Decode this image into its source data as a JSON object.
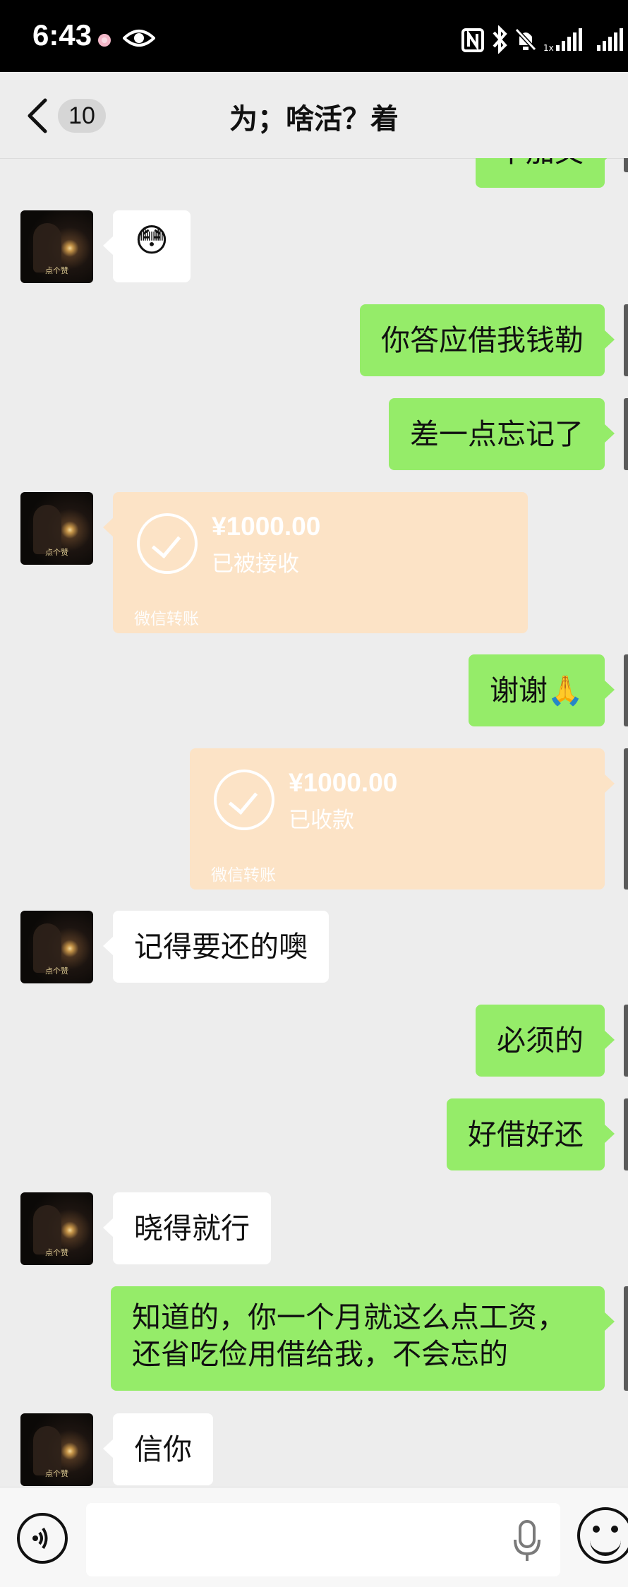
{
  "status_bar": {
    "time": "6:43",
    "icons": [
      "flower-icon",
      "eye-icon",
      "nfc-icon",
      "bluetooth-icon",
      "mute-icon",
      "signal-icon",
      "signal-icon"
    ]
  },
  "header": {
    "unread_count": "10",
    "title": "为；啥活？着"
  },
  "messages": [
    {
      "side": "right",
      "type": "text",
      "text": "不加文",
      "partial": true
    },
    {
      "side": "left",
      "type": "emoji",
      "text": "😳",
      "emoji_name": "confused-face-icon"
    },
    {
      "side": "right",
      "type": "text",
      "text": "你答应借我钱勒"
    },
    {
      "side": "right",
      "type": "text",
      "text": "差一点忘记了"
    },
    {
      "side": "left",
      "type": "transfer",
      "amount": "¥1000.00",
      "status": "已被接收",
      "brand": "微信转账"
    },
    {
      "side": "right",
      "type": "text",
      "text": "谢谢🙏"
    },
    {
      "side": "right",
      "type": "transfer",
      "amount": "¥1000.00",
      "status": "已收款",
      "brand": "微信转账"
    },
    {
      "side": "left",
      "type": "text",
      "text": "记得要还的噢"
    },
    {
      "side": "right",
      "type": "text",
      "text": "必须的"
    },
    {
      "side": "right",
      "type": "text",
      "text": "好借好还"
    },
    {
      "side": "left",
      "type": "text",
      "text": "晓得就行"
    },
    {
      "side": "right",
      "type": "text",
      "lines": [
        "知道的，你一个月就这么点工资，",
        "还省吃俭用借给我，不会忘的"
      ]
    },
    {
      "side": "left",
      "type": "text",
      "text": "信你"
    }
  ],
  "avatar_caption": "点个赞",
  "input_bar": {
    "placeholder": ""
  },
  "colors": {
    "background": "#ededed",
    "self_bubble": "#95ec69",
    "other_bubble": "#ffffff",
    "transfer_card": "#fce3c6",
    "status_bar": "#000000"
  }
}
